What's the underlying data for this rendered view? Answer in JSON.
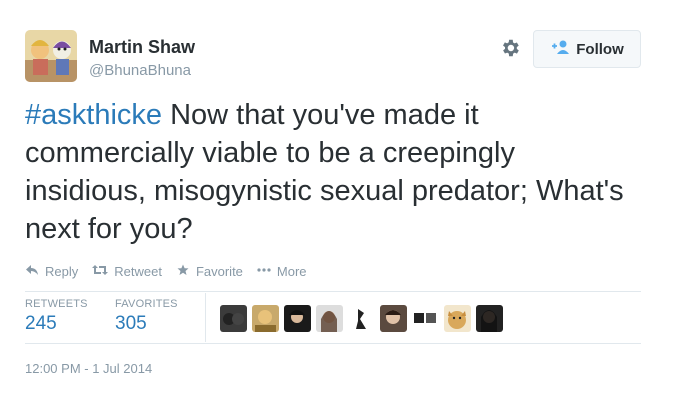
{
  "user": {
    "name": "Martin Shaw",
    "handle": "@BhunaBhuna"
  },
  "header": {
    "follow_label": "Follow"
  },
  "tweet": {
    "hashtag": "#askthicke",
    "text": " Now that you've made it commercially viable to be a creepingly insidious, misogynistic sexual predator; What's next for you?"
  },
  "actions": {
    "reply": "Reply",
    "retweet": "Retweet",
    "favorite": "Favorite",
    "more": "More"
  },
  "stats": {
    "retweets_label": "RETWEETS",
    "retweets_value": "245",
    "favorites_label": "FAVORITES",
    "favorites_value": "305"
  },
  "timestamp": "12:00 PM - 1 Jul 2014",
  "colors": {
    "link": "#2b7bb9",
    "muted": "#8899a6",
    "text": "#292f33",
    "border": "#e1e8ed"
  },
  "icons": [
    "gear-icon",
    "follow-person-icon",
    "reply-icon",
    "retweet-icon",
    "favorite-star-icon",
    "more-dots-icon"
  ]
}
